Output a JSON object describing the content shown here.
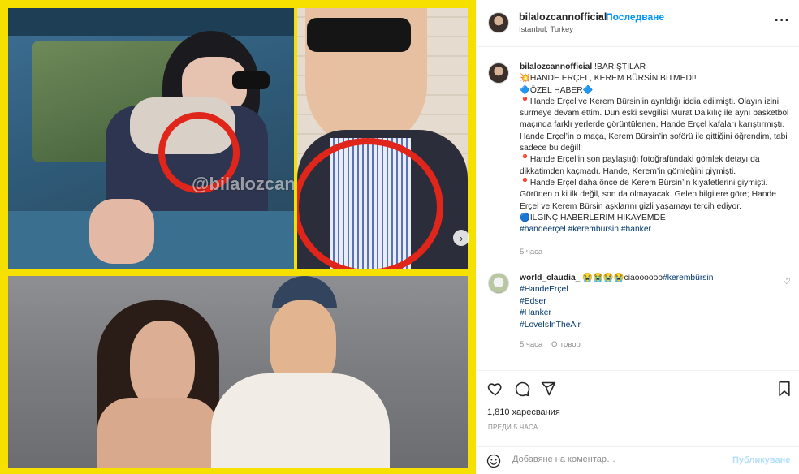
{
  "post": {
    "watermark": "@bilalozcannofficial",
    "next_glyph": "›"
  },
  "header": {
    "username": "bilalozcannofficial",
    "dot": "•",
    "follow": "Последване",
    "location": "Istanbul, Turkey",
    "more": "···"
  },
  "caption": {
    "username": "bilalozcannofficial",
    "lines": [
      "!BARIŞTILAR",
      "💥HANDE ERÇEL, KEREM BÜRSİN BİTMEDİ!",
      "🔷ÖZEL HABER🔷",
      "📍Hande Erçel ve Kerem Bürsin’in ayrıldığı iddia edilmişti. Olayın izini sürmeye devam ettim. Dün eski sevgilisi Murat Dalkılıç ile aynı basketbol maçında farklı yerlerde görüntülenen, Hande Erçel kafaları karıştırmıştı. Hande Erçel’in o maça, Kerem Bürsin’in şoförü ile gittiğini öğrendim, tabi sadece bu değil!",
      "📍Hande Erçel’in son paylaştığı fotoğraftındaki gömlek detayı da dikkatimden kaçmadı. Hande, Kerem’in gömleğini giymişti.",
      "📍Hande Erçel daha önce de Kerem Bürsin’in kıyafetlerini giymişti. Görünen o ki ilk değil, son da olmayacak. Gelen bilgilere göre; Hande Erçel ve Kerem Bürsin aşklarını gizli yaşamayı tercih ediyor.",
      "🔵İLGİNÇ HABERLERİM HİKAYEMDE"
    ],
    "tags": "#handeerçel #kerembursin #hanker",
    "time": "5 часа"
  },
  "comment": {
    "username": "world_claudia_",
    "text": " 😭😭😭😭ciaoooooo",
    "tags": [
      "#kerembürsin",
      "#HandeErçel",
      "#Edser",
      "#Hanker",
      "#LoveIsInTheAir"
    ],
    "time": "5 часа",
    "reply": "Отговор",
    "heart": "♡"
  },
  "actions": {
    "likes": "1,810 харесвания",
    "ago": "ПРЕДИ 5 ЧАСА",
    "comment_placeholder": "Добавяне на коментар…",
    "publish": "Публикуване"
  }
}
